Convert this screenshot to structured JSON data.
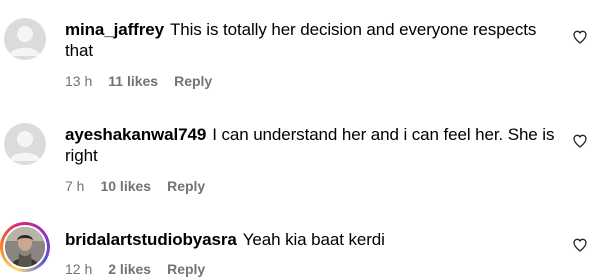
{
  "comments": [
    {
      "username": "mina_jaffrey",
      "text": "This is totally her decision and everyone respects that",
      "time": "13 h",
      "likes": "11 likes",
      "reply": "Reply"
    },
    {
      "username": "ayeshakanwal749",
      "text": "I can understand her and i can feel her. She is right",
      "time": "7 h",
      "likes": "10 likes",
      "reply": "Reply"
    },
    {
      "username": "bridalartstudiobyasra",
      "text": "Yeah kia baat kerdi",
      "time": "12 h",
      "likes": "2 likes",
      "reply": "Reply"
    }
  ],
  "icons": {
    "avatar_placeholder": "person-silhouette-icon",
    "like": "heart-outline-icon"
  },
  "colors": {
    "meta_text": "#737373",
    "placeholder_bg": "#dbdbdb"
  }
}
